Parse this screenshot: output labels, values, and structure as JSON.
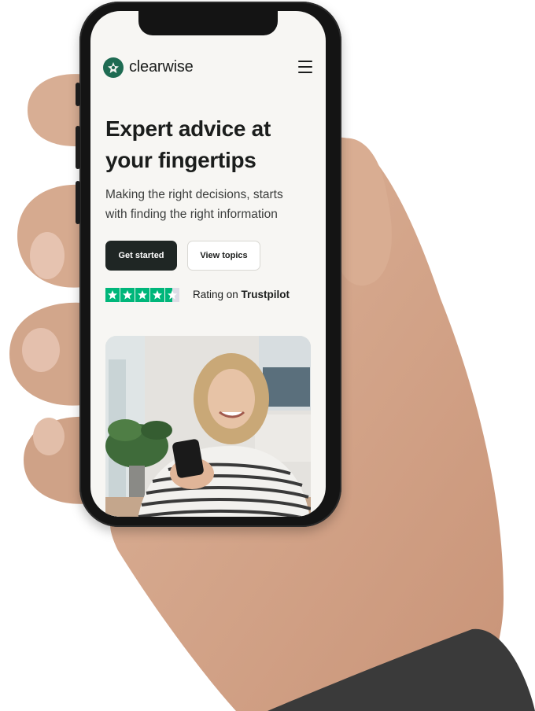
{
  "header": {
    "brand_name": "clearwise",
    "logo_icon": "clearwise-star-logo-icon",
    "menu_icon": "hamburger-menu-icon"
  },
  "hero": {
    "headline_line1": "Expert advice at",
    "headline_line2": "your fingertips",
    "subtext_line1": "Making the right decisions, starts",
    "subtext_line2": "with finding the right information"
  },
  "buttons": {
    "primary_label": "Get started",
    "secondary_label": "View topics"
  },
  "rating": {
    "prefix": "Rating on ",
    "brand": "Trustpilot",
    "stars_value": 4.5,
    "stars_max": 5
  },
  "colors": {
    "accent_green": "#1e6b52",
    "trustpilot_green": "#00b67a",
    "button_dark": "#1f2624",
    "screen_bg": "#f7f6f3"
  }
}
